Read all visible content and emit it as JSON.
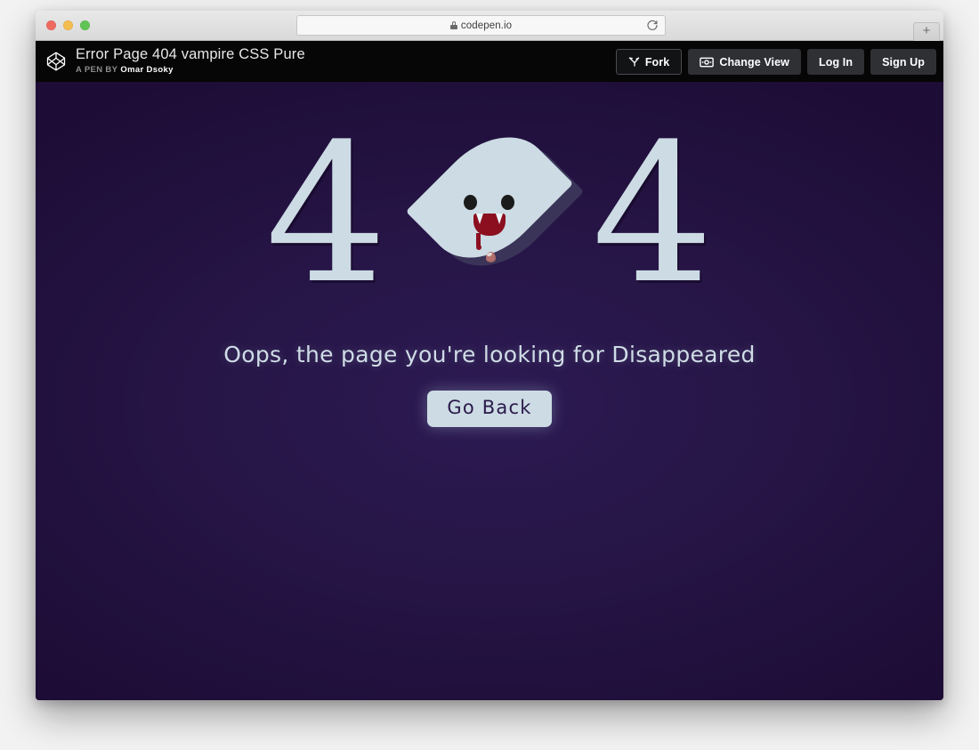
{
  "browser": {
    "traffic_lights": [
      {
        "name": "close",
        "color": "#ee6a5f"
      },
      {
        "name": "minimize",
        "color": "#f4bd4f"
      },
      {
        "name": "maximize",
        "color": "#61c454"
      }
    ],
    "url": "codepen.io",
    "lock_icon": "lock-icon",
    "reload_icon": "reload-icon",
    "new_tab_label": "+"
  },
  "pen_header": {
    "logo_icon": "codepen-logo-icon",
    "title": "Error Page 404 vampire CSS Pure",
    "byline_label": "A PEN BY",
    "byline_author": "Omar Dsoky",
    "actions": [
      {
        "label": "Fork",
        "icon": "fork-icon"
      },
      {
        "label": "Change View",
        "icon": "change-view-icon"
      },
      {
        "label": "Log In",
        "icon": ""
      },
      {
        "label": "Sign Up",
        "icon": ""
      }
    ]
  },
  "error_page": {
    "digit_left": "4",
    "digit_right": "4",
    "character": "vampire-ghost",
    "tagline": "Oops, the page you're looking for Disappeared",
    "go_back_label": "Go Back",
    "colors": {
      "background_center": "#2c1a52",
      "background_edge": "#1d0c35",
      "character_body": "#ccdbe4",
      "character_shadow": "#3b3459",
      "mouth": "#8c0f20",
      "blood_drop": "#b4716e",
      "text": "#cfdde6"
    }
  }
}
